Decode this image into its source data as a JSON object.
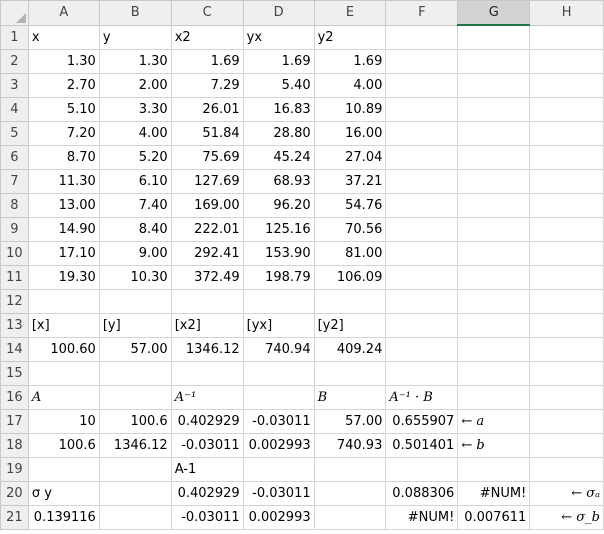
{
  "columns": [
    "A",
    "B",
    "C",
    "D",
    "E",
    "F",
    "G",
    "H"
  ],
  "selected_column": "G",
  "rows": [
    {
      "n": "1",
      "c": [
        {
          "v": "x",
          "a": "l"
        },
        {
          "v": "y",
          "a": "l"
        },
        {
          "v": "x2",
          "a": "l"
        },
        {
          "v": "yx",
          "a": "l"
        },
        {
          "v": "y2",
          "a": "l"
        },
        {
          "v": ""
        },
        {
          "v": ""
        },
        {
          "v": ""
        }
      ]
    },
    {
      "n": "2",
      "c": [
        {
          "v": "1.30",
          "a": "r"
        },
        {
          "v": "1.30",
          "a": "r"
        },
        {
          "v": "1.69",
          "a": "r"
        },
        {
          "v": "1.69",
          "a": "r"
        },
        {
          "v": "1.69",
          "a": "r"
        },
        {
          "v": ""
        },
        {
          "v": ""
        },
        {
          "v": ""
        }
      ]
    },
    {
      "n": "3",
      "c": [
        {
          "v": "2.70",
          "a": "r"
        },
        {
          "v": "2.00",
          "a": "r"
        },
        {
          "v": "7.29",
          "a": "r"
        },
        {
          "v": "5.40",
          "a": "r"
        },
        {
          "v": "4.00",
          "a": "r"
        },
        {
          "v": ""
        },
        {
          "v": ""
        },
        {
          "v": ""
        }
      ]
    },
    {
      "n": "4",
      "c": [
        {
          "v": "5.10",
          "a": "r"
        },
        {
          "v": "3.30",
          "a": "r"
        },
        {
          "v": "26.01",
          "a": "r"
        },
        {
          "v": "16.83",
          "a": "r"
        },
        {
          "v": "10.89",
          "a": "r"
        },
        {
          "v": ""
        },
        {
          "v": ""
        },
        {
          "v": ""
        }
      ]
    },
    {
      "n": "5",
      "c": [
        {
          "v": "7.20",
          "a": "r"
        },
        {
          "v": "4.00",
          "a": "r"
        },
        {
          "v": "51.84",
          "a": "r"
        },
        {
          "v": "28.80",
          "a": "r"
        },
        {
          "v": "16.00",
          "a": "r"
        },
        {
          "v": ""
        },
        {
          "v": ""
        },
        {
          "v": ""
        }
      ]
    },
    {
      "n": "6",
      "c": [
        {
          "v": "8.70",
          "a": "r"
        },
        {
          "v": "5.20",
          "a": "r"
        },
        {
          "v": "75.69",
          "a": "r"
        },
        {
          "v": "45.24",
          "a": "r"
        },
        {
          "v": "27.04",
          "a": "r"
        },
        {
          "v": ""
        },
        {
          "v": ""
        },
        {
          "v": ""
        }
      ]
    },
    {
      "n": "7",
      "c": [
        {
          "v": "11.30",
          "a": "r"
        },
        {
          "v": "6.10",
          "a": "r"
        },
        {
          "v": "127.69",
          "a": "r"
        },
        {
          "v": "68.93",
          "a": "r"
        },
        {
          "v": "37.21",
          "a": "r"
        },
        {
          "v": ""
        },
        {
          "v": ""
        },
        {
          "v": ""
        }
      ]
    },
    {
      "n": "8",
      "c": [
        {
          "v": "13.00",
          "a": "r"
        },
        {
          "v": "7.40",
          "a": "r"
        },
        {
          "v": "169.00",
          "a": "r"
        },
        {
          "v": "96.20",
          "a": "r"
        },
        {
          "v": "54.76",
          "a": "r"
        },
        {
          "v": ""
        },
        {
          "v": ""
        },
        {
          "v": ""
        }
      ]
    },
    {
      "n": "9",
      "c": [
        {
          "v": "14.90",
          "a": "r"
        },
        {
          "v": "8.40",
          "a": "r"
        },
        {
          "v": "222.01",
          "a": "r"
        },
        {
          "v": "125.16",
          "a": "r"
        },
        {
          "v": "70.56",
          "a": "r"
        },
        {
          "v": ""
        },
        {
          "v": ""
        },
        {
          "v": ""
        }
      ]
    },
    {
      "n": "10",
      "c": [
        {
          "v": "17.10",
          "a": "r"
        },
        {
          "v": "9.00",
          "a": "r"
        },
        {
          "v": "292.41",
          "a": "r"
        },
        {
          "v": "153.90",
          "a": "r"
        },
        {
          "v": "81.00",
          "a": "r"
        },
        {
          "v": ""
        },
        {
          "v": ""
        },
        {
          "v": ""
        }
      ]
    },
    {
      "n": "11",
      "c": [
        {
          "v": "19.30",
          "a": "r"
        },
        {
          "v": "10.30",
          "a": "r"
        },
        {
          "v": "372.49",
          "a": "r"
        },
        {
          "v": "198.79",
          "a": "r"
        },
        {
          "v": "106.09",
          "a": "r"
        },
        {
          "v": ""
        },
        {
          "v": ""
        },
        {
          "v": ""
        }
      ]
    },
    {
      "n": "12",
      "c": [
        {
          "v": ""
        },
        {
          "v": ""
        },
        {
          "v": ""
        },
        {
          "v": ""
        },
        {
          "v": ""
        },
        {
          "v": ""
        },
        {
          "v": ""
        },
        {
          "v": ""
        }
      ]
    },
    {
      "n": "13",
      "c": [
        {
          "v": "[x]",
          "a": "l"
        },
        {
          "v": "[y]",
          "a": "l"
        },
        {
          "v": "[x2]",
          "a": "l"
        },
        {
          "v": "[yx]",
          "a": "l"
        },
        {
          "v": "[y2]",
          "a": "l"
        },
        {
          "v": ""
        },
        {
          "v": ""
        },
        {
          "v": ""
        }
      ]
    },
    {
      "n": "14",
      "c": [
        {
          "v": "100.60",
          "a": "r"
        },
        {
          "v": "57.00",
          "a": "r"
        },
        {
          "v": "1346.12",
          "a": "r"
        },
        {
          "v": "740.94",
          "a": "r"
        },
        {
          "v": "409.24",
          "a": "r"
        },
        {
          "v": ""
        },
        {
          "v": ""
        },
        {
          "v": ""
        }
      ]
    },
    {
      "n": "15",
      "c": [
        {
          "v": ""
        },
        {
          "v": ""
        },
        {
          "v": ""
        },
        {
          "v": ""
        },
        {
          "v": ""
        },
        {
          "v": ""
        },
        {
          "v": ""
        },
        {
          "v": ""
        }
      ]
    },
    {
      "n": "16",
      "c": [
        {
          "v": "A",
          "a": "l",
          "i": true
        },
        {
          "v": ""
        },
        {
          "v": "A⁻¹",
          "a": "l",
          "i": true
        },
        {
          "v": ""
        },
        {
          "v": "B",
          "a": "l",
          "i": true
        },
        {
          "v": "A⁻¹ · B",
          "a": "l",
          "i": true
        },
        {
          "v": ""
        },
        {
          "v": ""
        }
      ]
    },
    {
      "n": "17",
      "c": [
        {
          "v": "10",
          "a": "r"
        },
        {
          "v": "100.6",
          "a": "r"
        },
        {
          "v": "0.402929",
          "a": "r"
        },
        {
          "v": "-0.03011",
          "a": "r"
        },
        {
          "v": "57.00",
          "a": "r"
        },
        {
          "v": "0.655907",
          "a": "r"
        },
        {
          "v": "← a",
          "a": "l",
          "i": true
        },
        {
          "v": ""
        }
      ]
    },
    {
      "n": "18",
      "c": [
        {
          "v": "100.6",
          "a": "r"
        },
        {
          "v": "1346.12",
          "a": "r"
        },
        {
          "v": "-0.03011",
          "a": "r"
        },
        {
          "v": "0.002993",
          "a": "r"
        },
        {
          "v": "740.93",
          "a": "r"
        },
        {
          "v": "0.501401",
          "a": "r"
        },
        {
          "v": "← b",
          "a": "l",
          "i": true
        },
        {
          "v": ""
        }
      ]
    },
    {
      "n": "19",
      "c": [
        {
          "v": ""
        },
        {
          "v": ""
        },
        {
          "v": "A-1",
          "a": "l"
        },
        {
          "v": ""
        },
        {
          "v": ""
        },
        {
          "v": ""
        },
        {
          "v": ""
        },
        {
          "v": ""
        }
      ]
    },
    {
      "n": "20",
      "c": [
        {
          "v": "σ y",
          "a": "l"
        },
        {
          "v": ""
        },
        {
          "v": "0.402929",
          "a": "r"
        },
        {
          "v": "-0.03011",
          "a": "r"
        },
        {
          "v": ""
        },
        {
          "v": "0.088306",
          "a": "r"
        },
        {
          "v": "#NUM!",
          "a": "r"
        },
        {
          "v": "← σₐ",
          "a": "r",
          "i": true
        }
      ]
    },
    {
      "n": "21",
      "c": [
        {
          "v": "0.139116",
          "a": "r"
        },
        {
          "v": ""
        },
        {
          "v": "-0.03011",
          "a": "r"
        },
        {
          "v": "0.002993",
          "a": "r"
        },
        {
          "v": ""
        },
        {
          "v": "#NUM!",
          "a": "r"
        },
        {
          "v": "0.007611",
          "a": "r"
        },
        {
          "v": "← σ_b",
          "a": "r",
          "i": true
        }
      ]
    }
  ]
}
